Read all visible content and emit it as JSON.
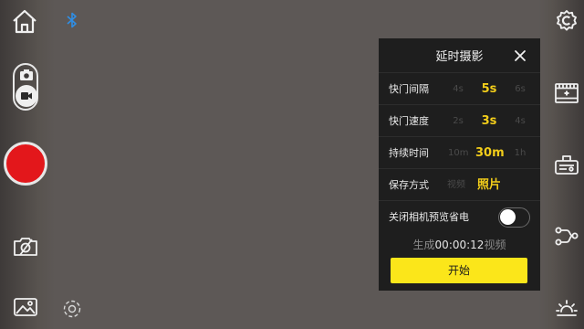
{
  "left_bar": {
    "icons": [
      "home-icon",
      "bluetooth-icon",
      "camera-icon",
      "video-icon",
      "camera-off-icon",
      "gallery-icon",
      "focus-icon"
    ],
    "selected_mode": "video",
    "shutter_color": "#e3171b"
  },
  "right_bar": {
    "icons": [
      "settings-icon",
      "slide-icon",
      "gimbal-icon",
      "motion-icon",
      "brightness-icon"
    ]
  },
  "panel": {
    "title": "延时摄影",
    "rows": [
      {
        "label": "快门间隔",
        "options": [
          "4s",
          "5s",
          "6s"
        ],
        "selected": "5s"
      },
      {
        "label": "快门速度",
        "options": [
          "2s",
          "3s",
          "4s"
        ],
        "selected": "3s"
      },
      {
        "label": "持续时间",
        "options": [
          "10m",
          "30m",
          "1h"
        ],
        "selected": "30m"
      },
      {
        "label": "保存方式",
        "options": [
          "视频",
          "照片"
        ],
        "selected": "照片"
      }
    ],
    "power_saving": {
      "label": "关闭相机预览省电",
      "enabled": false
    },
    "generate": {
      "prefix": "生成",
      "time": "00:00:12",
      "suffix": "视频"
    },
    "start_label": "开始"
  },
  "colors": {
    "accent": "#f2cd1a",
    "button": "#fbe61a",
    "bluetooth": "#2f8ee5"
  }
}
